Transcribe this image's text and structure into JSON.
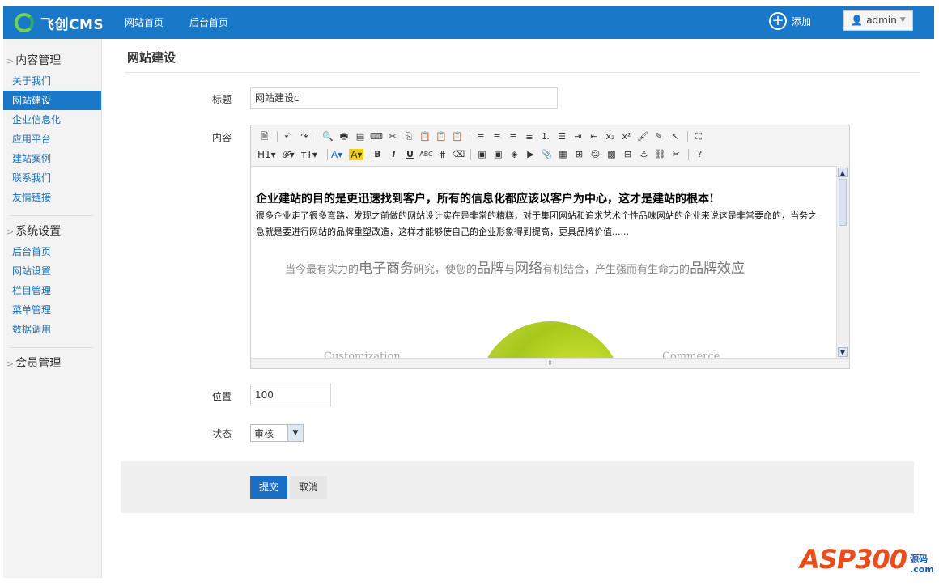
{
  "brand": {
    "logo_text": "飞创CMS"
  },
  "topnav": [
    {
      "label": "网站首页"
    },
    {
      "label": "后台首页"
    }
  ],
  "header_actions": {
    "add_label": "添加",
    "user_label": "admin"
  },
  "sidebar": {
    "sections": [
      {
        "title": "内容管理",
        "items": [
          {
            "label": "关于我们"
          },
          {
            "label": "网站建设",
            "active": true
          },
          {
            "label": "企业信息化"
          },
          {
            "label": "应用平台"
          },
          {
            "label": "建站案例"
          },
          {
            "label": "联系我们"
          },
          {
            "label": "友情链接"
          }
        ]
      },
      {
        "title": "系统设置",
        "items": [
          {
            "label": "后台首页"
          },
          {
            "label": "网站设置"
          },
          {
            "label": "栏目管理"
          },
          {
            "label": "菜单管理"
          },
          {
            "label": "数据调用"
          }
        ]
      },
      {
        "title": "会员管理",
        "items": []
      }
    ]
  },
  "page": {
    "title": "网站建设"
  },
  "form": {
    "title_label": "标题",
    "title_value": "网站建设c",
    "content_label": "内容",
    "position_label": "位置",
    "position_value": "100",
    "status_label": "状态",
    "status_value": "审核"
  },
  "editor": {
    "dropdowns": {
      "heading": "H1",
      "font": "𝓕",
      "size": "тT",
      "font_color": "A",
      "bg_color": "A"
    },
    "content": {
      "heading": "企业建站的目的是更迅速找到客户，所有的信息化都应该以客户为中心，这才是建站的根本!",
      "paragraph": "很多企业走了很多弯路，发现之前做的网站设计实在是非常的糟糕，对于集团网站和追求艺术个性品味网站的企业来说这是非常要命的，当务之急就是要进行网站的品牌重塑改造，这样才能够使自己的企业形象得到提高，更具品牌价值......",
      "banner_pre": "当今最有实力的",
      "banner_b1": "电子商务",
      "banner_mid1": "研究，使您的",
      "banner_b2": "品牌",
      "banner_mid2": "与",
      "banner_b3": "网络",
      "banner_mid3": "有机结合，产生强而有生命力的",
      "banner_b4": "品牌效应",
      "word_left": "Customization",
      "word_right": "Commerce"
    }
  },
  "actions": {
    "submit_label": "提交",
    "cancel_label": "取消"
  },
  "watermark": {
    "text": "ASP300",
    "side_top": "源码",
    "side_bottom": ".com"
  }
}
